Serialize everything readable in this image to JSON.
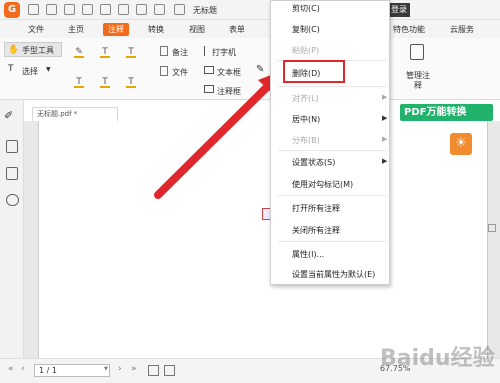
{
  "title_bar": {
    "doc_title": "无标题",
    "right_label": "登录"
  },
  "tabs": [
    {
      "label": "文件",
      "active": false
    },
    {
      "label": "主页",
      "active": false
    },
    {
      "label": "注释",
      "active": true
    },
    {
      "label": "转换",
      "active": false
    },
    {
      "label": "视图",
      "active": false
    },
    {
      "label": "表单",
      "active": false
    },
    {
      "label": "特色功能",
      "active": false
    },
    {
      "label": "云服务",
      "active": false
    }
  ],
  "ribbon": {
    "hand_tool": "手型工具",
    "select": "选择",
    "note": "备注",
    "file": "文件",
    "typewriter": "打字机",
    "textbox": "文本框",
    "callout": "注释框",
    "manage_notes": "管理注释"
  },
  "doc_tab": {
    "name": "无标题.pdf *"
  },
  "context_menu": {
    "items": [
      {
        "label": "剪切(C)",
        "disabled": false
      },
      {
        "label": "复制(C)",
        "disabled": false
      },
      {
        "label": "粘贴(P)",
        "disabled": true
      },
      {
        "label": "删除(D)",
        "disabled": false,
        "highlighted": true
      },
      {
        "label": "对齐(L)",
        "disabled": true,
        "submenu": true
      },
      {
        "label": "居中(N)",
        "disabled": false,
        "submenu": true
      },
      {
        "label": "分布(B)",
        "disabled": true,
        "submenu": true
      },
      {
        "label": "设置状态(S)",
        "disabled": false,
        "submenu": true
      },
      {
        "label": "使用对勾标记(M)",
        "disabled": false
      },
      {
        "label": "打开所有注释",
        "disabled": false
      },
      {
        "label": "关闭所有注释",
        "disabled": false
      },
      {
        "label": "属性(I)...",
        "disabled": false
      },
      {
        "label": "设置当前属性为默认(E)",
        "disabled": false
      }
    ]
  },
  "promo": {
    "banner": "PDF万能转换"
  },
  "status_bar": {
    "page_indicator": "1 / 1",
    "zoom": "67.75%"
  },
  "watermark": "Baidu经验",
  "colors": {
    "accent": "#f26b1d",
    "highlight_red": "#e0282c",
    "promo_green": "#21b36b"
  }
}
